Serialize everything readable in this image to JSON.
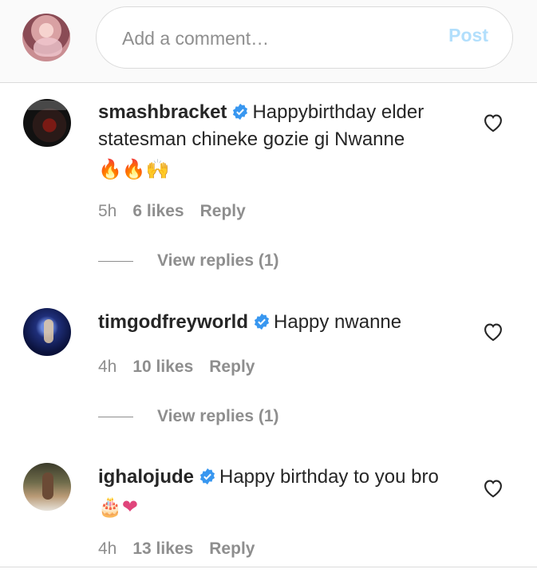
{
  "composer": {
    "placeholder": "Add a comment…",
    "post_label": "Post",
    "post_color": "#b2dffc"
  },
  "comments": [
    {
      "username": "smashbracket",
      "verified": true,
      "text": "Happybirthday elder statesman chineke gozie gi Nwanne",
      "emojis": "🔥🔥🙌",
      "time": "5h",
      "likes": "6 likes",
      "reply_label": "Reply",
      "view_replies": "View replies (1)"
    },
    {
      "username": "timgodfreyworld",
      "verified": true,
      "text": "Happy nwanne",
      "time": "4h",
      "likes": "10 likes",
      "reply_label": "Reply",
      "view_replies": "View replies (1)"
    },
    {
      "username": "ighalojude",
      "verified": true,
      "text": "Happy birthday to you bro",
      "emojis": "🎂❤",
      "time": "4h",
      "likes": "13 likes",
      "reply_label": "Reply"
    }
  ],
  "colors": {
    "verified_badge": "#3897f0",
    "meta_gray": "#8e8e8e",
    "heart_emoji": "#e0457b"
  },
  "icons": {
    "verified": "verified-badge-icon",
    "like": "heart-outline-icon"
  }
}
